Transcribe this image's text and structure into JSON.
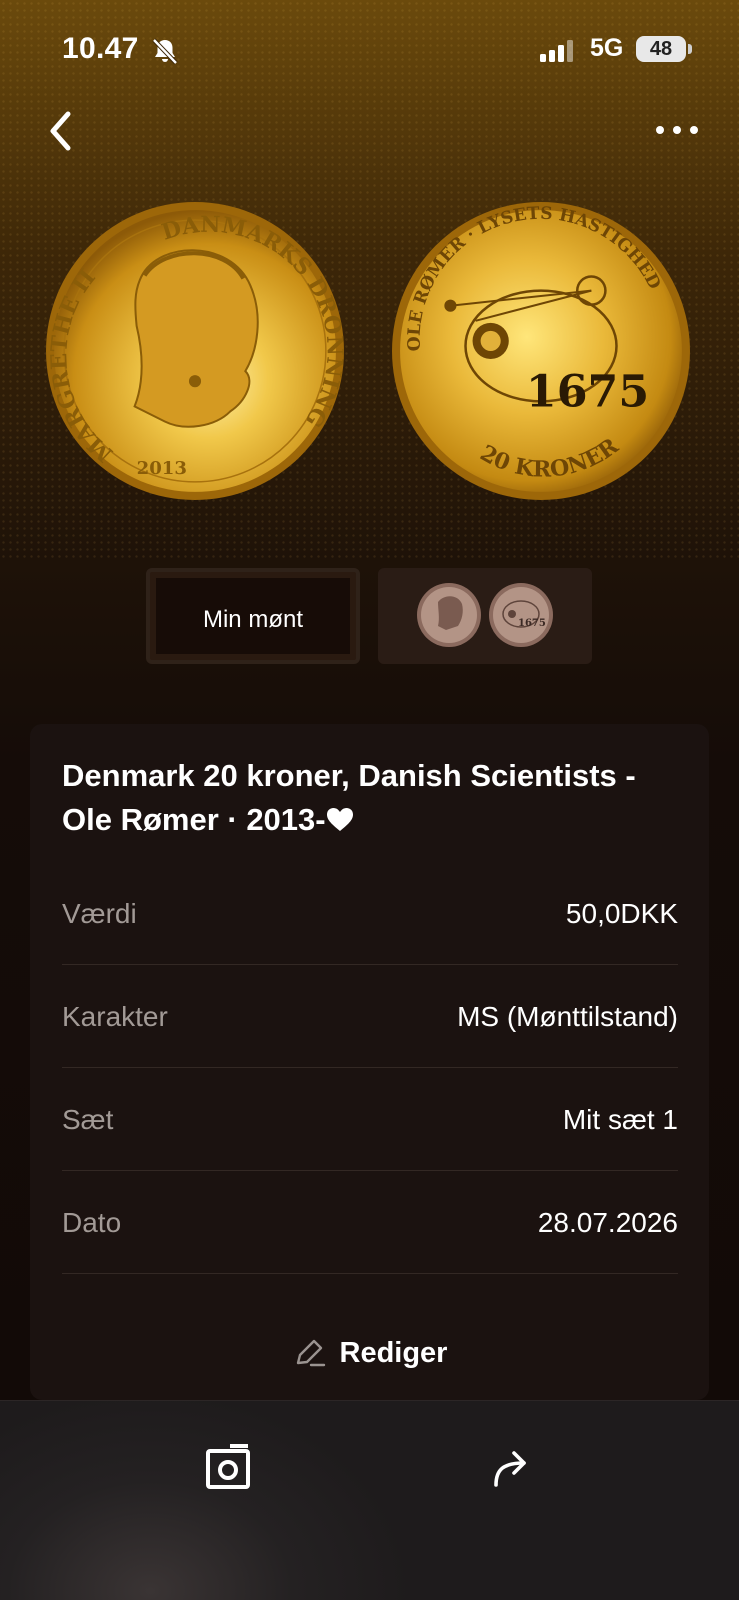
{
  "status": {
    "time": "10.47",
    "network": "5G",
    "battery": "48"
  },
  "nav": {
    "back_icon": "chevron-left-icon",
    "more_icon": "ellipsis-icon"
  },
  "coin_images": {
    "obverse": {
      "top_text": "DANMARKS DRONNING",
      "left_text": "MARGRETHE II",
      "year": "2013"
    },
    "reverse": {
      "top_text": "OLE RØMER · LYSETS HASTIGHED",
      "date": "1675",
      "denomination": "20 KRONER"
    }
  },
  "selector": {
    "mine_label": "Min mønt"
  },
  "coin": {
    "title": "Denmark 20 kroner, Danish Scientists - Ole Rømer · 2013-",
    "favorite_icon": "heart-icon",
    "details": [
      {
        "label": "Værdi",
        "value": "50,0DKK"
      },
      {
        "label": "Karakter",
        "value": "MS (Mønttilstand)"
      },
      {
        "label": "Sæt",
        "value": "Mit sæt 1"
      },
      {
        "label": "Dato",
        "value": "28.07.2026"
      }
    ],
    "edit_label": "Rediger"
  },
  "toolbar": {
    "photo_icon": "camera-frame-icon",
    "share_icon": "share-arrow-icon"
  },
  "colors": {
    "gold": "#d9a325",
    "card": "#1b1210",
    "muted_text": "#a29a96"
  }
}
